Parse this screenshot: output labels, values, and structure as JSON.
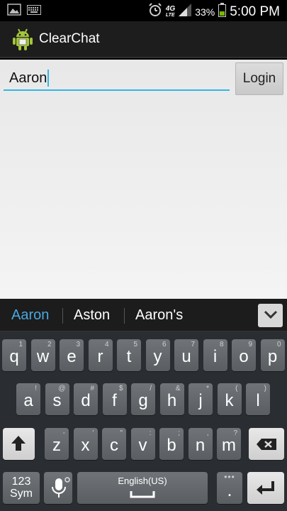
{
  "status_bar": {
    "network": "4G",
    "network_sub": "LTE",
    "battery_percent": "33%",
    "time": "5:00 PM"
  },
  "app": {
    "title": "ClearChat"
  },
  "login_form": {
    "username_value": "Aaron",
    "login_label": "Login"
  },
  "keyboard": {
    "suggestions": [
      "Aaron",
      "Aston",
      "Aaron's"
    ],
    "rows": [
      [
        {
          "label": "q",
          "hint": "1"
        },
        {
          "label": "w",
          "hint": "2"
        },
        {
          "label": "e",
          "hint": "3"
        },
        {
          "label": "r",
          "hint": "4"
        },
        {
          "label": "t",
          "hint": "5"
        },
        {
          "label": "y",
          "hint": "6"
        },
        {
          "label": "u",
          "hint": "7"
        },
        {
          "label": "i",
          "hint": "8"
        },
        {
          "label": "o",
          "hint": "9"
        },
        {
          "label": "p",
          "hint": "0"
        }
      ],
      [
        {
          "label": "a",
          "hint": "!"
        },
        {
          "label": "s",
          "hint": "@"
        },
        {
          "label": "d",
          "hint": "#"
        },
        {
          "label": "f",
          "hint": "$"
        },
        {
          "label": "g",
          "hint": "/"
        },
        {
          "label": "h",
          "hint": "&"
        },
        {
          "label": "j",
          "hint": "*"
        },
        {
          "label": "k",
          "hint": "("
        },
        {
          "label": "l",
          "hint": ")"
        }
      ],
      [
        {
          "label": "z",
          "hint": "-"
        },
        {
          "label": "x",
          "hint": "'"
        },
        {
          "label": "c",
          "hint": "\""
        },
        {
          "label": "v",
          "hint": ":"
        },
        {
          "label": "b",
          "hint": ";"
        },
        {
          "label": "n",
          "hint": ","
        },
        {
          "label": "m",
          "hint": "?"
        }
      ]
    ],
    "sym_label_1": "123",
    "sym_label_2": "Sym",
    "space_label": "English(US)",
    "period_label": ".",
    "period_hint": "•••"
  }
}
